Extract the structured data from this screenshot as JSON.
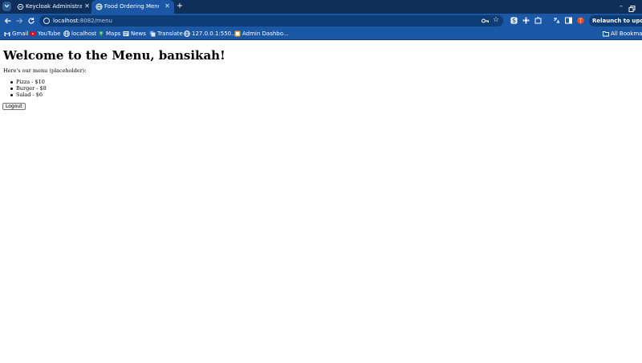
{
  "browser": {
    "tabs": [
      {
        "title": "Keycloak Administratio",
        "active": false,
        "favicon": "keycloak-icon"
      },
      {
        "title": "Food Ordering Menu",
        "active": true,
        "favicon": "globe-icon"
      }
    ],
    "toolbar": {
      "url_host": "localhost",
      "url_path": ":8082/menu",
      "relaunch_label": "Relaunch to update"
    },
    "bookmarks": [
      {
        "label": "Gmail",
        "icon": "gmail-icon"
      },
      {
        "label": "YouTube",
        "icon": "youtube-icon"
      },
      {
        "label": "localhost",
        "icon": "globe-icon"
      },
      {
        "label": "Maps",
        "icon": "maps-icon"
      },
      {
        "label": "News",
        "icon": "news-icon"
      },
      {
        "label": "Translate",
        "icon": "translate-icon"
      },
      {
        "label": "127.0.0.1:550...",
        "icon": "globe-icon"
      },
      {
        "label": "Admin Dashbo...",
        "icon": "admin-icon"
      }
    ],
    "all_bookmarks_label": "All Bookmarks"
  },
  "page": {
    "heading": "Welcome to the Menu, bansikah!",
    "intro": "Here's our menu (placeholder):",
    "menu_items": [
      "Pizza - $10",
      "Burger - $8",
      "Salad - $6"
    ],
    "logout_label": "Logout"
  }
}
